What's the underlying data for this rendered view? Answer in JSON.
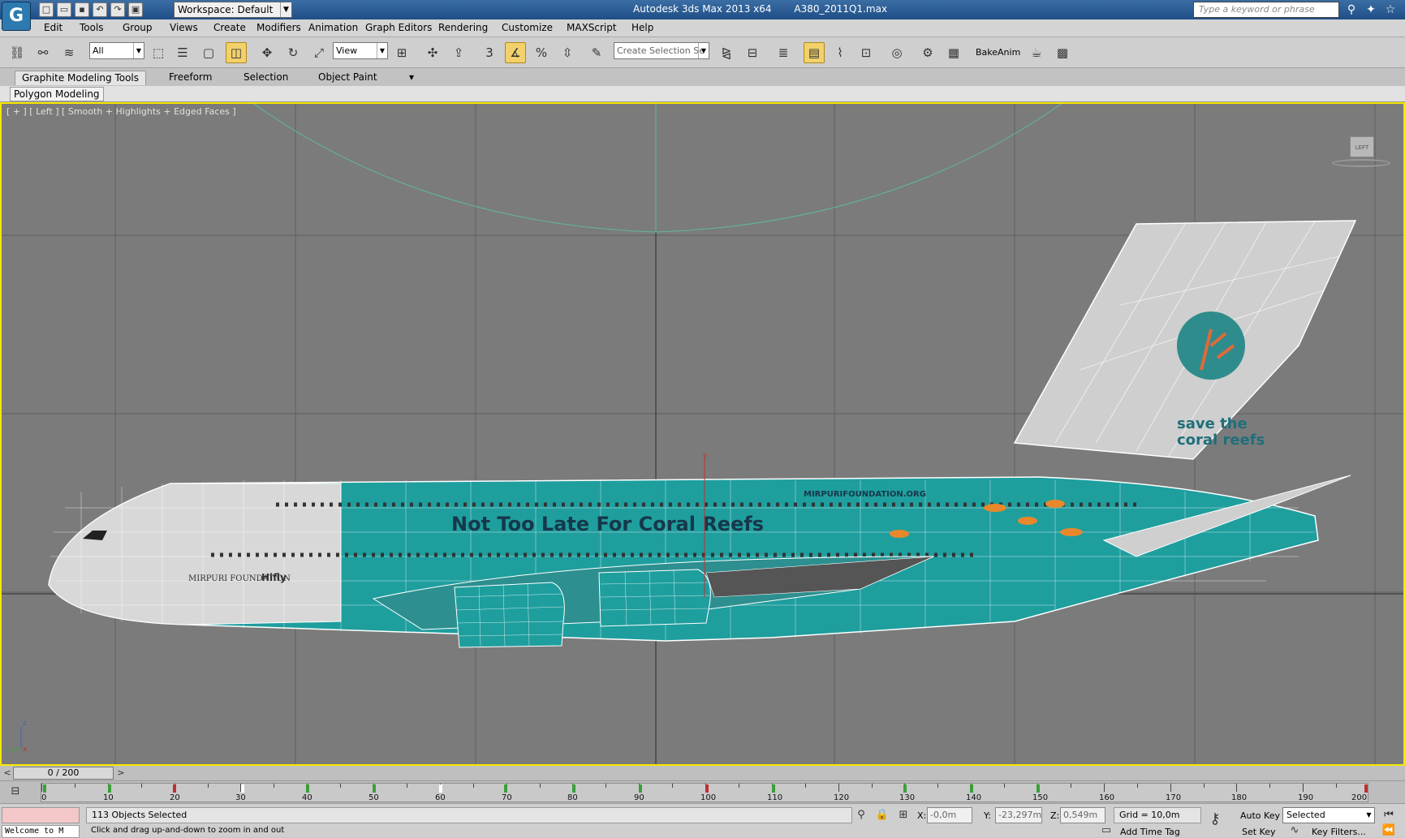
{
  "titlebar": {
    "app_title": "Autodesk 3ds Max  2013 x64",
    "file_name": "A380_2011Q1.max",
    "workspace": "Workspace: Default",
    "search_placeholder": "Type a keyword or phrase"
  },
  "menu": [
    "Edit",
    "Tools",
    "Group",
    "Views",
    "Create",
    "Modifiers",
    "Animation",
    "Graph Editors",
    "Rendering",
    "Customize",
    "MAXScript",
    "Help"
  ],
  "toolbar": {
    "selection_filter": "All",
    "ref_coord": "View",
    "snap_3": "3",
    "named_selection": "Create Selection Se",
    "bake_anim": "BakeAnim"
  },
  "ribbon": {
    "tabs": [
      "Graphite Modeling Tools",
      "Freeform",
      "Selection",
      "Object Paint"
    ],
    "panel": "Polygon Modeling"
  },
  "viewport": {
    "label": "[ + ] [ Left ] [ Smooth + Highlights + Edged Faces ]",
    "viewcube_label": "LEFT",
    "livery": {
      "slogan": "Not Too Late For Coral Reefs",
      "website": "MIRPURIFOUNDATION.ORG",
      "tail_line1": "save the",
      "tail_line2": "coral reefs",
      "foundation": "MIRPURI\nFOUNDATION",
      "airline": "Hifly"
    },
    "colors": {
      "teal": "#1f9e9e",
      "grid": "#6b6b6b",
      "wire": "#ffffff"
    }
  },
  "timeline": {
    "frame_display": "0 / 200",
    "ticks": [
      "0",
      "10",
      "20",
      "30",
      "40",
      "50",
      "60",
      "70",
      "80",
      "90",
      "100",
      "110",
      "120",
      "130",
      "140",
      "150",
      "160",
      "170",
      "180",
      "190",
      "200"
    ]
  },
  "status": {
    "listener": "Welcome to M",
    "selection": "113 Objects Selected",
    "prompt": "Click and drag up-and-down to zoom in and out",
    "x_label": "X:",
    "x_value": "-0,0m",
    "y_label": "Y:",
    "y_value": "-23,297m",
    "z_label": "Z:",
    "z_value": "0,549m",
    "grid": "Grid = 10,0m",
    "add_time_tag": "Add Time Tag",
    "auto_key": "Auto Key",
    "set_key": "Set Key",
    "key_mode": "Selected",
    "key_filters": "Key Filters..."
  }
}
